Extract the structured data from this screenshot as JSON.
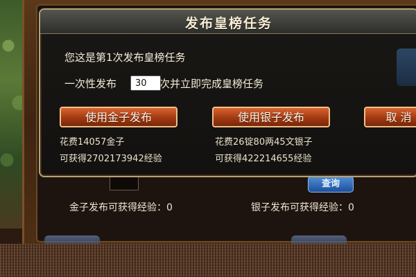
{
  "modal": {
    "title": "发布皇榜任务",
    "first_time_text": "您这是第1次发布皇榜任务",
    "publish_once_label": "一次性发布",
    "publish_count": "30",
    "complete_label": "次并立即完成皇榜任务",
    "gold_button": "使用金子发布",
    "silver_button": "使用银子发布",
    "cancel_button": "取 消",
    "gold_cost": "花费14057金子",
    "gold_exp": "可获得2702173942经验",
    "silver_cost": "花费26锭80两45文银子",
    "silver_exp": "可获得422214655经验"
  },
  "background_panel": {
    "gold_exp_label": "金子发布可获得经验：",
    "gold_exp_value": "0",
    "silver_exp_label": "银子发布可获得经验：",
    "silver_exp_value": "0",
    "query_button": "查询"
  },
  "colors": {
    "modal_border": "#b9a27a",
    "button_orange": "#c44d1f",
    "title_text": "#f7eed6",
    "query_blue": "#2f6fc0"
  }
}
